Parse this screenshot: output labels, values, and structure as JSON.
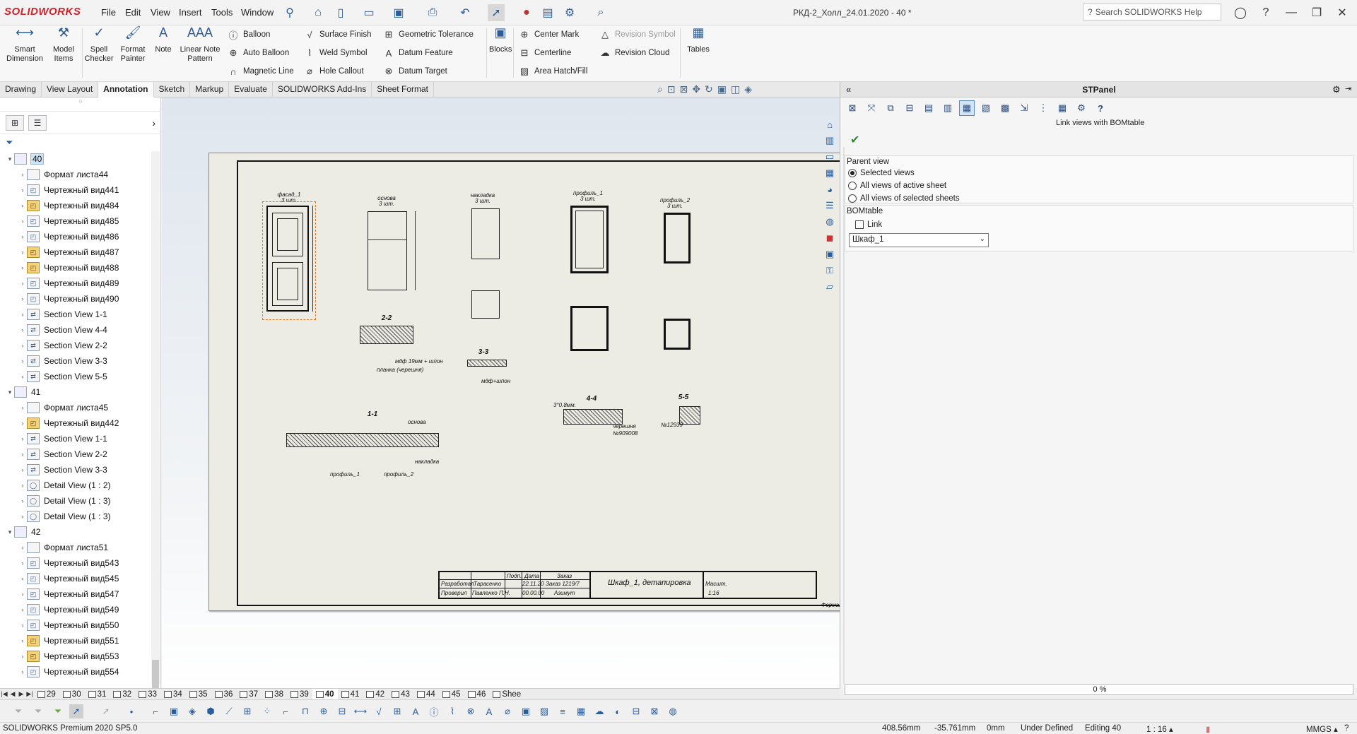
{
  "app": {
    "logo": "SOLIDWORKS",
    "doc_title": "РКД-2_Холл_24.01.2020 - 40 *",
    "help_placeholder": "Search SOLIDWORKS Help"
  },
  "menu": [
    "File",
    "Edit",
    "View",
    "Insert",
    "Tools",
    "Window"
  ],
  "ribbon": {
    "smart_dimension": "Smart Dimension",
    "model_items": "Model Items",
    "spell_checker": "Spell Checker",
    "format_painter": "Format Painter",
    "note": "Note",
    "linear_note": "Linear Note Pattern",
    "balloon": "Balloon",
    "auto_balloon": "Auto Balloon",
    "magnetic_line": "Magnetic Line",
    "surface_finish": "Surface Finish",
    "weld_symbol": "Weld Symbol",
    "hole_callout": "Hole Callout",
    "geo_tol": "Geometric Tolerance",
    "datum_feature": "Datum Feature",
    "datum_target": "Datum Target",
    "blocks": "Blocks",
    "center_mark": "Center Mark",
    "centerline": "Centerline",
    "area_hatch": "Area Hatch/Fill",
    "revision_symbol": "Revision Symbol",
    "revision_cloud": "Revision Cloud",
    "tables": "Tables"
  },
  "tabs": [
    "Drawing",
    "View Layout",
    "Annotation",
    "Sketch",
    "Markup",
    "Evaluate",
    "SOLIDWORKS Add-Ins",
    "Sheet Format"
  ],
  "tree": [
    {
      "label": "40",
      "type": "sheet",
      "level": 0,
      "expand": "▾",
      "sel": true
    },
    {
      "label": "Формат листа44",
      "type": "fmt",
      "level": 1
    },
    {
      "label": "Чертежный вид441",
      "type": "view",
      "level": 1
    },
    {
      "label": "Чертежный вид484",
      "type": "gold",
      "level": 1
    },
    {
      "label": "Чертежный вид485",
      "type": "view",
      "level": 1
    },
    {
      "label": "Чертежный вид486",
      "type": "view",
      "level": 1
    },
    {
      "label": "Чертежный вид487",
      "type": "gold",
      "level": 1
    },
    {
      "label": "Чертежный вид488",
      "type": "gold",
      "level": 1
    },
    {
      "label": "Чертежный вид489",
      "type": "view",
      "level": 1
    },
    {
      "label": "Чертежный вид490",
      "type": "view",
      "level": 1
    },
    {
      "label": "Section View 1-1",
      "type": "sec",
      "level": 1
    },
    {
      "label": "Section View 4-4",
      "type": "sec",
      "level": 1
    },
    {
      "label": "Section View 2-2",
      "type": "sec",
      "level": 1
    },
    {
      "label": "Section View 3-3",
      "type": "sec",
      "level": 1
    },
    {
      "label": "Section View 5-5",
      "type": "sec",
      "level": 1
    },
    {
      "label": "41",
      "type": "sheet",
      "level": 0,
      "expand": "▾"
    },
    {
      "label": "Формат листа45",
      "type": "fmt",
      "level": 1
    },
    {
      "label": "Чертежный вид442",
      "type": "gold",
      "level": 1
    },
    {
      "label": "Section View 1-1",
      "type": "sec",
      "level": 1
    },
    {
      "label": "Section View 2-2",
      "type": "sec",
      "level": 1
    },
    {
      "label": "Section View 3-3",
      "type": "sec",
      "level": 1
    },
    {
      "label": "Detail View  (1 : 2)",
      "type": "det",
      "level": 1
    },
    {
      "label": "Detail View  (1 : 3)",
      "type": "det",
      "level": 1
    },
    {
      "label": "Detail View  (1 : 3)",
      "type": "det",
      "level": 1
    },
    {
      "label": "42",
      "type": "sheet",
      "level": 0,
      "expand": "▾"
    },
    {
      "label": "Формат листа51",
      "type": "fmt",
      "level": 1
    },
    {
      "label": "Чертежный вид543",
      "type": "view",
      "level": 1
    },
    {
      "label": "Чертежный вид545",
      "type": "view",
      "level": 1
    },
    {
      "label": "Чертежный вид547",
      "type": "view",
      "level": 1
    },
    {
      "label": "Чертежный вид549",
      "type": "view",
      "level": 1
    },
    {
      "label": "Чертежный вид550",
      "type": "view",
      "level": 1
    },
    {
      "label": "Чертежный вид551",
      "type": "gold",
      "level": 1
    },
    {
      "label": "Чертежный вид553",
      "type": "gold",
      "level": 1
    },
    {
      "label": "Чертежный вид554",
      "type": "view",
      "level": 1
    }
  ],
  "drawing": {
    "v1": "фасад_1",
    "v1b": "3 шт.",
    "v2": "основа",
    "v2b": "3 шт.",
    "v3": "накладка",
    "v3b": "3 шт.",
    "v4": "профиль_1",
    "v4b": "3 шт.",
    "v5": "профиль_2",
    "v5b": "3 шт.",
    "s22": "2-2",
    "s33": "3-3",
    "s44": "4-4",
    "s55": "5-5",
    "s11": "1-1",
    "n1": "мдф 19мм + шпон",
    "n2": "планка (черешня)",
    "n3": "мдф+шпон",
    "n4": "основа",
    "n5": "накладка",
    "n6": "профиль_1",
    "n7": "профиль_2",
    "n8": "черешня",
    "n9": "№909008",
    "n10": "№12939",
    "n11": "3°0.8мм.",
    "tb_title": "Шкаф_1, детапировка",
    "tb_dev": "Разработал",
    "tb_dev_name": "Тарасенко",
    "tb_chk": "Проверил",
    "tb_chk_name": "Павленко П.Н.",
    "tb_sign": "Подп.",
    "tb_date": "Дата",
    "tb_date_v": "22.11.20",
    "tb_date2": "00.00.00",
    "tb_order": "Заказ",
    "tb_order_v": "Заказ 1219/7",
    "tb_client": "Азимут",
    "tb_scale_h": "Масшт.",
    "tb_scale": "1:16",
    "tb_format": "Формат"
  },
  "stpanel": {
    "title": "STPanel",
    "hint": "Link views with BOMtable",
    "parent_view": "Parent view",
    "opt1": "Selected views",
    "opt2": "All views of active sheet",
    "opt3": "All views of selected sheets",
    "bom": "BOMtable",
    "link": "Link",
    "bom_value": "Шкаф_1",
    "progress": "0 %"
  },
  "sheets": [
    "29",
    "30",
    "31",
    "32",
    "33",
    "34",
    "35",
    "36",
    "37",
    "38",
    "39",
    "40",
    "41",
    "42",
    "43",
    "44",
    "45",
    "46",
    "Shee"
  ],
  "active_sheet": "40",
  "status": {
    "product": "SOLIDWORKS Premium 2020 SP5.0",
    "x": "408.56mm",
    "y": "-35.761mm",
    "z": "0mm",
    "state": "Under Defined",
    "editing": "Editing 40",
    "scale": "1 : 16",
    "units": "MMGS"
  }
}
